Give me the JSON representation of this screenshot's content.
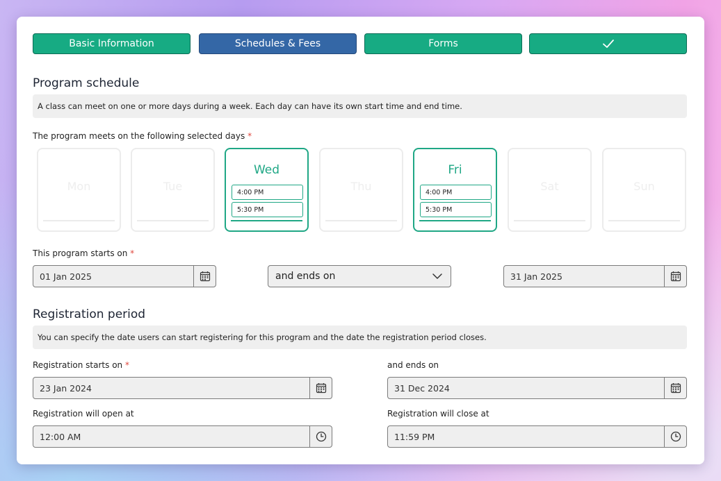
{
  "steps": [
    {
      "label": "Basic Information",
      "state": "complete"
    },
    {
      "label": "Schedules & Fees",
      "state": "active"
    },
    {
      "label": "Forms",
      "state": "complete"
    },
    {
      "label": "",
      "state": "complete",
      "icon": "checkmark-icon"
    }
  ],
  "schedule": {
    "title": "Program schedule",
    "info": "A class can meet on one or more days during a week. Each day can have its own start time and end time.",
    "days_label": "The program meets on the following selected days",
    "required_mark": "*",
    "days": [
      {
        "name": "Mon",
        "selected": false
      },
      {
        "name": "Tue",
        "selected": false
      },
      {
        "name": "Wed",
        "selected": true,
        "start": "4:00 PM",
        "end": "5:30 PM"
      },
      {
        "name": "Thu",
        "selected": false
      },
      {
        "name": "Fri",
        "selected": true,
        "start": "4:00 PM",
        "end": "5:30 PM"
      },
      {
        "name": "Sat",
        "selected": false
      },
      {
        "name": "Sun",
        "selected": false
      }
    ],
    "starts_label": "This program starts on",
    "start_date": "01 Jan 2025",
    "end_mode": "and ends on",
    "end_date": "31 Jan 2025"
  },
  "registration": {
    "title": "Registration period",
    "info": "You can specify the date users can start registering for this program and the date the registration period closes.",
    "starts_label": "Registration starts on",
    "ends_label": "and ends on",
    "start_date": "23 Jan 2024",
    "end_date": "31 Dec 2024",
    "open_label": "Registration will open at",
    "close_label": "Registration will close at",
    "open_time": "12:00 AM",
    "close_time": "11:59 PM"
  },
  "colors": {
    "accent_green": "#1fa785",
    "step_green": "#17ab83",
    "step_active_blue": "#3467a6",
    "required_red": "#e0483e"
  }
}
